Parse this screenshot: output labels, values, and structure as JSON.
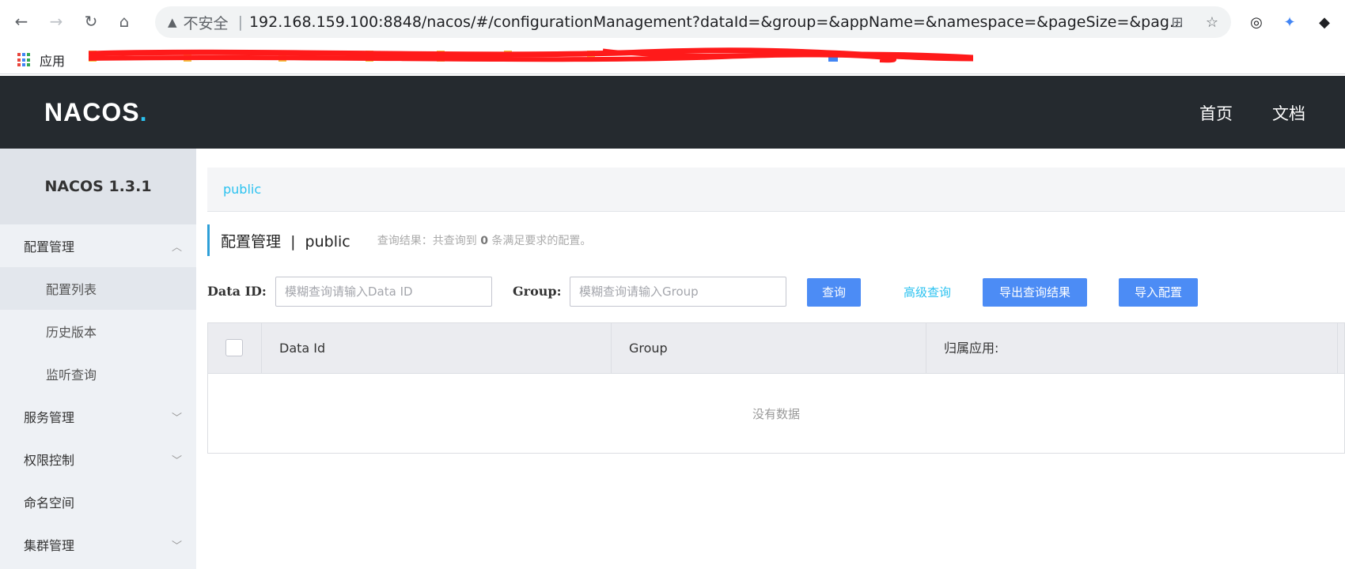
{
  "browser": {
    "insecure_label": "不安全",
    "url": "192.168.159.100:8848/nacos/#/configurationManagement?dataId=&group=&appName=&namespace=&pageSize=&pag...",
    "apps_label": "应用"
  },
  "header": {
    "logo": "NACOS",
    "logo_dot": ".",
    "nav": [
      "首页",
      "文档"
    ]
  },
  "sidebar": {
    "title": "NACOS 1.3.1",
    "items": [
      {
        "label": "配置管理"
      },
      {
        "label": "配置列表"
      },
      {
        "label": "历史版本"
      },
      {
        "label": "监听查询"
      },
      {
        "label": "服务管理"
      },
      {
        "label": "权限控制"
      },
      {
        "label": "命名空间"
      },
      {
        "label": "集群管理"
      }
    ]
  },
  "main": {
    "namespace_tab": "public",
    "page_title": "配置管理  |  public",
    "hint_prefix": "查询结果：共查询到",
    "hint_count": "0",
    "hint_suffix": "条满足要求的配置。",
    "search": {
      "data_id_label": "Data ID:",
      "data_id_placeholder": "模糊查询请输入Data ID",
      "group_label": "Group:",
      "group_placeholder": "模糊查询请输入Group",
      "query_button": "查询",
      "advanced_link": "高级查询",
      "export_button": "导出查询结果",
      "import_button": "导入配置"
    },
    "table": {
      "columns": [
        "Data Id",
        "Group",
        "归属应用:"
      ],
      "empty_text": "没有数据"
    }
  },
  "colors": {
    "header_bg": "#252a2f",
    "accent": "#2bc2f0",
    "primary_button": "#4c8cf5"
  }
}
